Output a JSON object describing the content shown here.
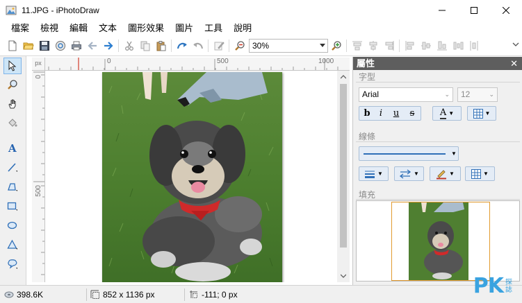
{
  "window": {
    "title": "11.JPG - iPhotoDraw",
    "minimize_icon": "minimize-icon",
    "maximize_icon": "maximize-icon",
    "close_icon": "close-icon"
  },
  "menu": {
    "items": [
      "檔案",
      "檢視",
      "編輯",
      "文本",
      "圖形效果",
      "圖片",
      "工具",
      "說明"
    ]
  },
  "toolbar": {
    "zoom_value": "30%",
    "icons": [
      "new-icon",
      "open-icon",
      "save-icon",
      "web-icon",
      "print-icon",
      "undo-icon",
      "redo-icon",
      "cut-icon",
      "copy-icon",
      "paste-icon",
      "rotate-left-icon",
      "rotate-right-icon",
      "edit-icon",
      "zoom-out-icon",
      "zoom-in-icon",
      "align-icons",
      "overflow-chevron-icon"
    ]
  },
  "left_tools": {
    "icons": [
      "pointer-icon",
      "zoom-icon",
      "hand-icon",
      "paint-bucket-icon",
      "text-icon",
      "line-icon",
      "polyline-icon",
      "rectangle-icon",
      "ellipse-icon",
      "triangle-icon",
      "callout-icon"
    ]
  },
  "rulers": {
    "unit": "px",
    "h_ticks": [
      "0",
      "500",
      "1000"
    ],
    "v_ticks": [
      "0",
      "500"
    ]
  },
  "properties": {
    "title": "屬性",
    "close": "✕",
    "font_section": "字型",
    "font_name": "Arial",
    "font_size": "12",
    "format_buttons": [
      "b",
      "i",
      "u",
      "s"
    ],
    "text_color_label": "A",
    "line_section": "線條",
    "fill_section": "填充"
  },
  "status": {
    "file_size": "398.6K",
    "dimensions": "852 x 1136 px",
    "cursor": "-111; 0 px"
  },
  "watermark": {
    "big": "PK",
    "small_line1": "探",
    "small_line2": "誌"
  },
  "colors": {
    "accent_blue": "#3aa3e0",
    "panel_header": "#5e5e5e",
    "selection": "#cde5f7",
    "frame_orange": "#e29a2e"
  }
}
